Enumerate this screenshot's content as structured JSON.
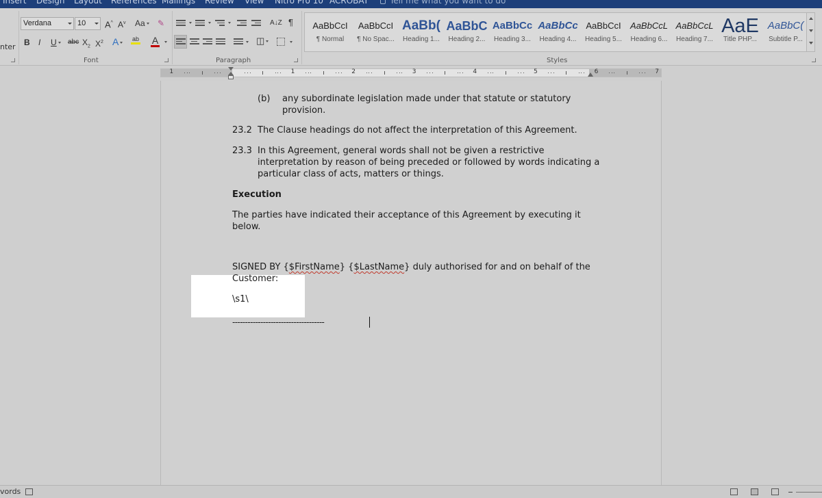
{
  "menu_tabs": [
    "Insert",
    "Design",
    "Layout",
    "References",
    "Mailings",
    "Review",
    "View",
    "Nitro Pro 10",
    "ACROBAT"
  ],
  "tell_me": "Tell me what you want to do",
  "clipboard_partial_label": "nter",
  "font": {
    "name": "Verdana",
    "size": "10",
    "group_label": "Font",
    "grow": "A",
    "shrink": "A",
    "change_case": "Aa",
    "bold": "B",
    "italic": "I",
    "underline": "U",
    "strikethrough": "abc",
    "subscript": "X",
    "superscript": "X",
    "text_effects": "A",
    "highlight": "ab",
    "font_color": "A",
    "font_color_hex": "#c00000",
    "highlight_hex": "#e8e000"
  },
  "paragraph": {
    "group_label": "Paragraph",
    "show_marks": "¶",
    "sort": "A↓Z"
  },
  "styles": {
    "group_label": "Styles",
    "items": [
      {
        "sample": "AaBbCcI",
        "name": "¶ Normal",
        "color": "#222222"
      },
      {
        "sample": "AaBbCcI",
        "name": "¶ No Spac...",
        "color": "#222222"
      },
      {
        "sample": "AaBb(",
        "name": "Heading 1...",
        "color": "#2f5496"
      },
      {
        "sample": "AaBbC",
        "name": "Heading 2...",
        "color": "#2f5496"
      },
      {
        "sample": "AaBbCc",
        "name": "Heading 3...",
        "color": "#2f5496"
      },
      {
        "sample": "AaBbCc",
        "name": "Heading 4...",
        "color": "#2f5496"
      },
      {
        "sample": "AaBbCcI",
        "name": "Heading 5...",
        "color": "#222222"
      },
      {
        "sample": "AaBbCcL",
        "name": "Heading 6...",
        "color": "#222222"
      },
      {
        "sample": "AaBbCcL",
        "name": "Heading 7...",
        "color": "#222222"
      },
      {
        "sample": "AaE",
        "name": "Title PHP...",
        "color": "#1f3864"
      },
      {
        "sample": "AaBbC(",
        "name": "Subtitle P...",
        "color": "#2f5496"
      }
    ]
  },
  "ruler": {
    "numbers": [
      "1",
      "1",
      "2",
      "3",
      "4",
      "5",
      "6",
      "7"
    ]
  },
  "document": {
    "item_b_label": "(b)",
    "item_b_line1": "any subordinate legislation made under that statute or statutory",
    "item_b_line2": "provision.",
    "c232_num": "23.2",
    "c232_text": "The Clause headings do not affect the interpretation of this Agreement.",
    "c233_num": "23.3",
    "c233_line1": "In this Agreement, general words shall not be given a restrictive",
    "c233_line2": "interpretation by reason of being preceded or followed by words indicating a",
    "c233_line3": "particular class of acts, matters or things.",
    "execution_heading": "Execution",
    "acceptance_line1": "The parties have indicated their acceptance of this Agreement by executing it",
    "acceptance_line2": "below.",
    "signed_by": "SIGNED BY {",
    "first_name": "$FirstName",
    "between": "} {",
    "last_name": "$LastName",
    "signed_rest": "} duly authorised for and on behalf of the",
    "customer": "Customer:",
    "sig_tag": "\\s1\\",
    "sig_line": "------------------------------------"
  },
  "status": {
    "words_partial": "vords"
  }
}
